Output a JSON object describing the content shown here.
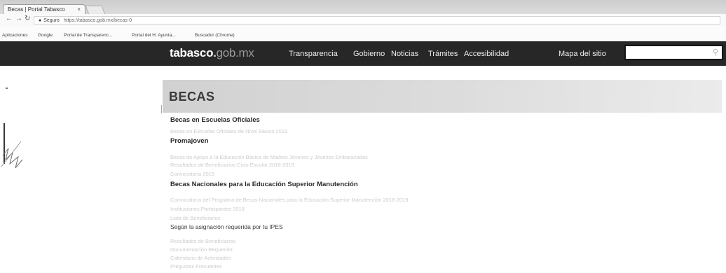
{
  "browser": {
    "tab_title": "Becas | Portal Tabasco",
    "tab_close": "×",
    "back": "←",
    "forward": "→",
    "reload": "↻",
    "secure_label": "Seguro",
    "url": "https://tabasco.gob.mx/becas-0",
    "bookmarks": [
      "Aplicaciones",
      "Google",
      "Portal de Transparenc...",
      "Portal del H. Ayunta...",
      "Buscador (Chrome)"
    ]
  },
  "site": {
    "logo_main": "tabasco",
    "logo_dot": ".",
    "logo_rest": "gob.mx",
    "nav": [
      "Transparencia",
      "Gobierno",
      "Noticias",
      "Trámites",
      "Accesibilidad",
      "Mapa del sitio"
    ],
    "search_icon": "search-icon"
  },
  "page": {
    "title": "BECAS",
    "sections": [
      {
        "heading": "Becas en Escuelas Oficiales",
        "lines": [
          "Becas en Escuelas Oficiales de Nivel Básico 2019"
        ]
      },
      {
        "heading": "Promajoven",
        "lines": [
          "Becas de Apoyo a la Educación Básica de Madres Jóvenes y Jóvenes Embarazadas",
          "Resultados de Beneficiarios Ciclo Escolar 2018-2019",
          "Convocatoria 2019"
        ]
      },
      {
        "heading": "Becas Nacionales para la Educación Superior Manutención",
        "lines": [
          "Convocatoria del Programa de Becas Nacionales para la Educación Superior Manutención 2018-2019",
          "Instituciones Participantes 2018",
          "Lista de Beneficiarios"
        ],
        "note": "Según la asignación requerida por tu IPES",
        "trailing": [
          "Resultados de Beneficiarios",
          "Documentación Requerida",
          "Calendario de Actividades",
          "Preguntas Frecuentes"
        ]
      }
    ]
  },
  "colors": {
    "site_header": "#2b2b2b",
    "banner": "#d4d4d4",
    "banner_text": "#3d3d3d"
  }
}
